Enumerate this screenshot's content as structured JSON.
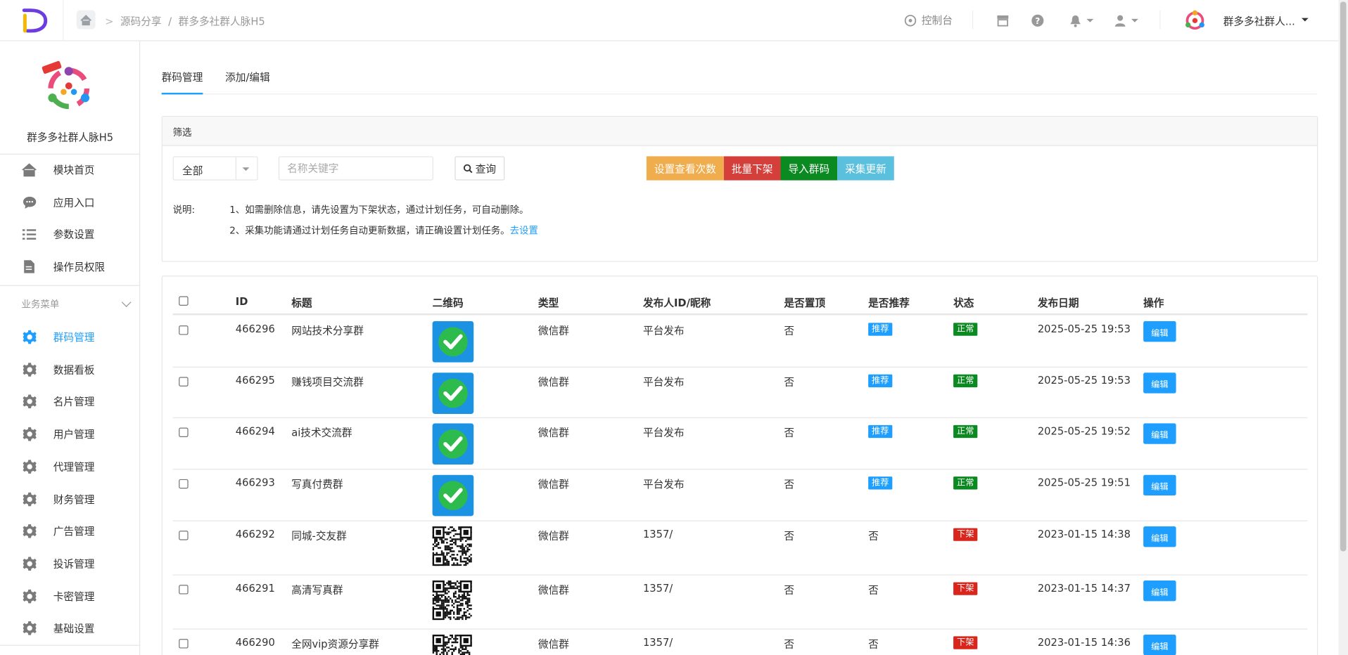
{
  "header": {
    "breadcrumb": [
      "源码分享",
      "/",
      "群多多社群人脉H5"
    ],
    "console_label": "控制台",
    "user_name": "群多多社群人..."
  },
  "sidebar": {
    "app_title": "群多多社群人脉H5",
    "top_items": [
      {
        "label": "模块首页",
        "icon": "home-icon"
      },
      {
        "label": "应用入口",
        "icon": "chat-icon"
      },
      {
        "label": "参数设置",
        "icon": "list-icon"
      },
      {
        "label": "操作员权限",
        "icon": "document-icon"
      }
    ],
    "group_label": "业务菜单",
    "group_items": [
      {
        "label": "群码管理",
        "active": true
      },
      {
        "label": "数据看板"
      },
      {
        "label": "名片管理"
      },
      {
        "label": "用户管理"
      },
      {
        "label": "代理管理"
      },
      {
        "label": "财务管理"
      },
      {
        "label": "广告管理"
      },
      {
        "label": "投诉管理"
      },
      {
        "label": "卡密管理"
      },
      {
        "label": "基础设置"
      }
    ]
  },
  "tabs": [
    {
      "label": "群码管理",
      "active": true
    },
    {
      "label": "添加/编辑"
    }
  ],
  "filter": {
    "title": "筛选",
    "select_value": "全部",
    "keyword_placeholder": "名称关键字",
    "query_label": "查询",
    "actions": [
      {
        "label": "设置查看次数",
        "color": "#f0ad4e"
      },
      {
        "label": "批量下架",
        "color": "#d43f3a"
      },
      {
        "label": "导入群码",
        "color": "#0a8a20"
      },
      {
        "label": "采集更新",
        "color": "#5bc0de"
      }
    ],
    "note_label": "说明:",
    "note_1": "1、如需删除信息，请先设置为下架状态，通过计划任务，可自动删除。",
    "note_2": "2、采集功能请通过计划任务自动更新数据，请正确设置计划任务。",
    "note_2_link": "去设置"
  },
  "table": {
    "columns": [
      "ID",
      "标题",
      "二维码",
      "类型",
      "发布人ID/昵称",
      "是否置顶",
      "是否推荐",
      "状态",
      "发布日期",
      "操作"
    ],
    "edit_label": "编辑",
    "rows": [
      {
        "id": "466296",
        "title": "网站技术分享群",
        "qr": "check",
        "type": "微信群",
        "publisher": "平台发布",
        "top": "否",
        "recommend": "推荐",
        "status": "正常",
        "date": "2025-05-25 19:53"
      },
      {
        "id": "466295",
        "title": "赚钱项目交流群",
        "qr": "check",
        "type": "微信群",
        "publisher": "平台发布",
        "top": "否",
        "recommend": "推荐",
        "status": "正常",
        "date": "2025-05-25 19:53"
      },
      {
        "id": "466294",
        "title": "ai技术交流群",
        "qr": "check",
        "type": "微信群",
        "publisher": "平台发布",
        "top": "否",
        "recommend": "推荐",
        "status": "正常",
        "date": "2025-05-25 19:52"
      },
      {
        "id": "466293",
        "title": "写真付费群",
        "qr": "check",
        "type": "微信群",
        "publisher": "平台发布",
        "top": "否",
        "recommend": "推荐",
        "status": "正常",
        "date": "2025-05-25 19:51"
      },
      {
        "id": "466292",
        "title": "同城-交友群",
        "qr": "code",
        "type": "微信群",
        "publisher": "1357/",
        "top": "否",
        "recommend": "否",
        "status": "下架",
        "date": "2023-01-15 14:38"
      },
      {
        "id": "466291",
        "title": "高清写真群",
        "qr": "code",
        "type": "微信群",
        "publisher": "1357/",
        "top": "否",
        "recommend": "否",
        "status": "下架",
        "date": "2023-01-15 14:37"
      },
      {
        "id": "466290",
        "title": "全网vip资源分享群",
        "qr": "code",
        "type": "微信群",
        "publisher": "1357/",
        "top": "否",
        "recommend": "否",
        "status": "下架",
        "date": "2023-01-15 14:36"
      }
    ]
  }
}
